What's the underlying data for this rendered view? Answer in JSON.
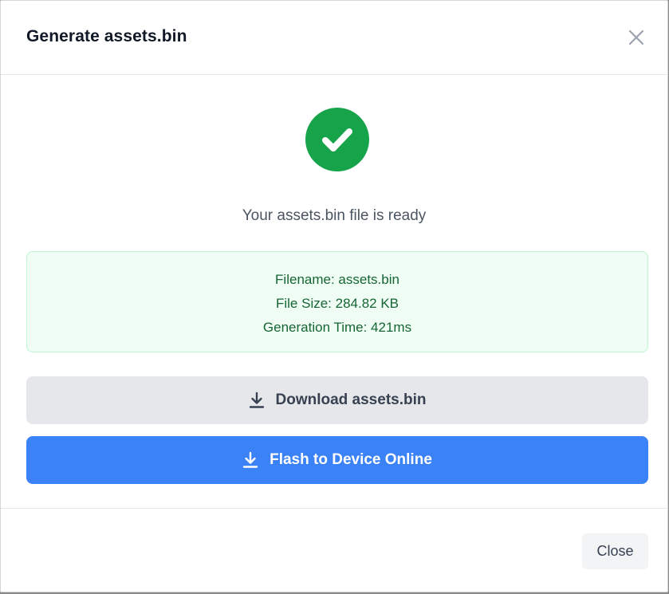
{
  "modal": {
    "title": "Generate assets.bin",
    "status_message": "Your assets.bin file is ready",
    "details": {
      "filename": "Filename: assets.bin",
      "file_size": "File Size: 284.82 KB",
      "generation_time": "Generation Time: 421ms"
    },
    "actions": {
      "download_label": "Download assets.bin",
      "flash_label": "Flash to Device Online"
    },
    "footer": {
      "close_label": "Close"
    },
    "icons": {
      "close": "close-icon",
      "success": "check-circle-icon",
      "download": "download-icon"
    },
    "colors": {
      "success": "#16a34a",
      "info_bg": "#f0fdf4",
      "info_border": "#bbf7d0",
      "info_text": "#166534",
      "primary": "#3b82f6",
      "secondary": "#e5e7eb"
    }
  }
}
